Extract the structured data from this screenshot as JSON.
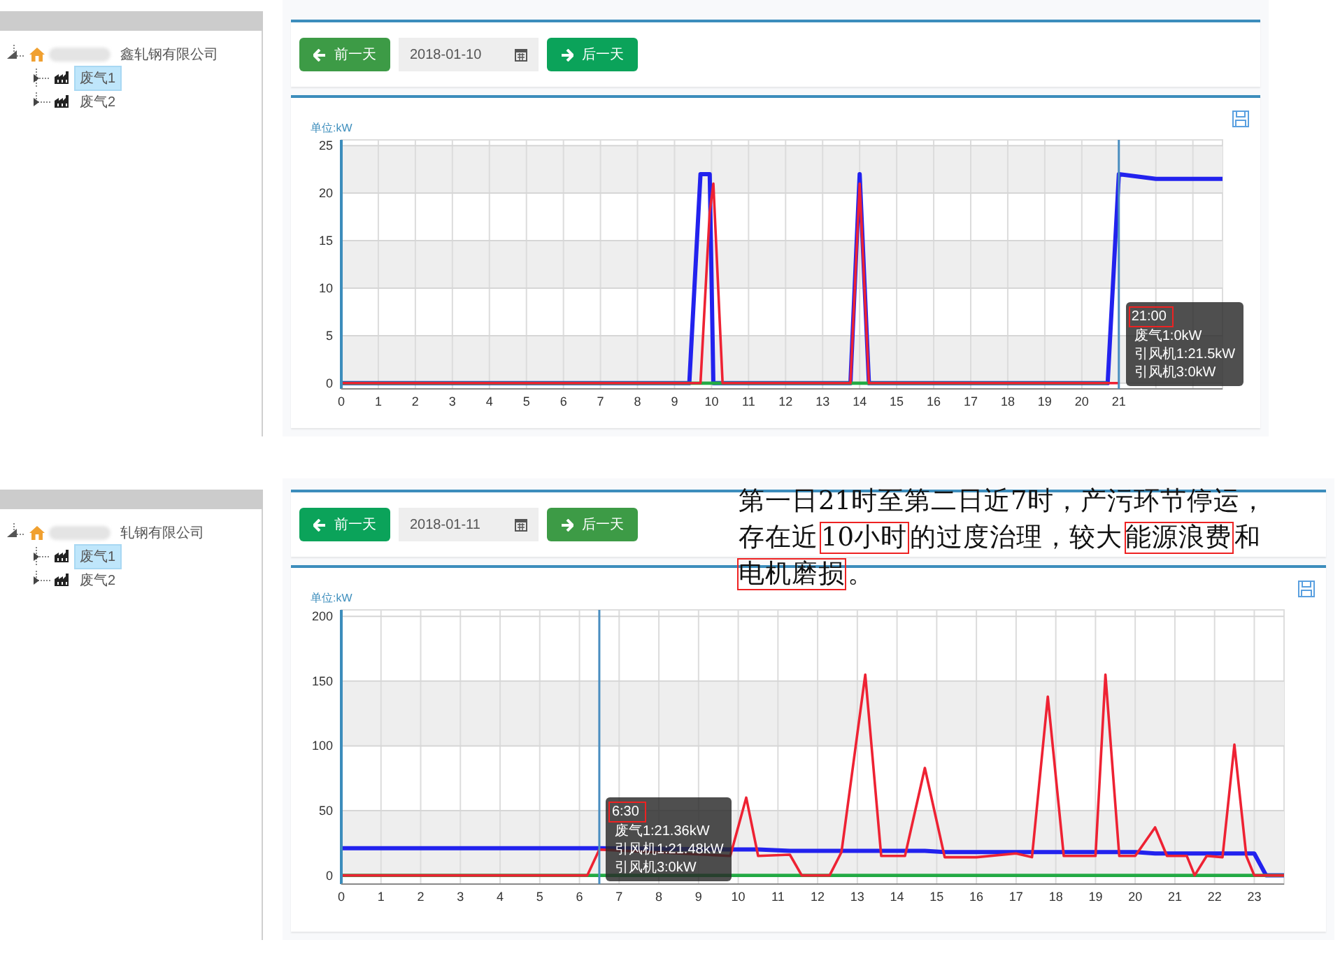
{
  "screens": [
    {
      "sidebar": {
        "tree": [
          {
            "label": "鑫轧钢有限公司",
            "redacted": true,
            "expanded": true,
            "children": [
              {
                "label": "废气1",
                "selected": true
              },
              {
                "label": "废气2",
                "selected": false
              }
            ]
          }
        ]
      },
      "toolbar": {
        "prev_button": {
          "label": "前一天",
          "hovered": true
        },
        "date_field": {
          "value": "2018-01-10"
        },
        "next_button": {
          "label": "后一天",
          "hovered": false
        }
      },
      "chart": {
        "unit_label": "单位:kW",
        "chart_data": {
          "type": "line",
          "x": [
            0,
            9.4,
            9.7,
            9.95,
            10.05,
            10.3,
            13.75,
            14,
            14.25,
            20.7,
            21,
            22,
            23,
            23.8
          ],
          "series": [
            {
              "color": "#2222ee",
              "values": [
                0,
                0,
                22,
                22,
                0,
                0,
                0,
                22,
                0,
                0,
                22,
                21.5,
                21.5,
                21.5
              ]
            },
            {
              "color": "#22aa44",
              "values": [
                0,
                0,
                0,
                0,
                0,
                0,
                0,
                0,
                0,
                0,
                null,
                null,
                null,
                null
              ]
            },
            {
              "color": "#ee2233",
              "values": [
                0,
                0,
                0,
                18,
                21,
                0,
                0,
                21,
                0,
                0,
                0,
                null,
                null,
                null
              ]
            }
          ],
          "xlim": [
            0,
            23.8
          ],
          "ylim": [
            -0.6,
            25.6
          ],
          "xticks": [
            0,
            1,
            2,
            3,
            4,
            5,
            6,
            7,
            8,
            9,
            10,
            11,
            12,
            13,
            14,
            15,
            16,
            17,
            18,
            19,
            20,
            21
          ],
          "yticks": [
            0,
            5,
            10,
            15,
            20,
            25
          ],
          "grid": true,
          "ref_lines": [
            {
              "axis": "x",
              "value": 21
            }
          ]
        },
        "tooltip": {
          "title": "21:00",
          "title_boxed": true,
          "lines": [
            "废气1:0kW",
            "引风机1:21.5kW",
            "引风机3:0kW"
          ]
        }
      }
    },
    {
      "sidebar": {
        "tree": [
          {
            "label": "轧钢有限公司",
            "redacted": true,
            "expanded": true,
            "children": [
              {
                "label": "废气1",
                "selected": true
              },
              {
                "label": "废气2",
                "selected": false
              }
            ]
          }
        ]
      },
      "toolbar": {
        "prev_button": {
          "label": "前一天",
          "hovered": false
        },
        "date_field": {
          "value": "2018-01-11"
        },
        "next_button": {
          "label": "后一天",
          "hovered": true
        }
      },
      "annotation": {
        "lines": [
          [
            {
              "text": "第一日21时至第二日近7时，产污环节停运，",
              "boxed": false
            }
          ],
          [
            {
              "text": "存在近",
              "boxed": false
            },
            {
              "text": "10小时",
              "boxed": true
            },
            {
              "text": "的过度治理，较大",
              "boxed": false
            },
            {
              "text": "能源浪费",
              "boxed": true
            },
            {
              "text": "和",
              "boxed": false
            }
          ],
          [
            {
              "text": "电机磨损",
              "boxed": true
            },
            {
              "text": "。",
              "boxed": false
            }
          ]
        ]
      },
      "chart": {
        "unit_label": "单位:kW",
        "chart_data": {
          "type": "line",
          "x": [
            0,
            6.2,
            6.5,
            9.8,
            10.2,
            10.5,
            11.3,
            11.6,
            12.3,
            12.6,
            13.2,
            13.6,
            14.2,
            14.7,
            15.2,
            16,
            17,
            17.4,
            17.8,
            18.2,
            19,
            19.25,
            19.6,
            20,
            20.5,
            20.8,
            21.3,
            21.5,
            21.8,
            22.2,
            22.5,
            22.8,
            23,
            23.3,
            23.75
          ],
          "series": [
            {
              "color": "#2222ee",
              "values": [
                21,
                21,
                21,
                20,
                20,
                20,
                19,
                19,
                19,
                19,
                19,
                19,
                19,
                19,
                18,
                18,
                18,
                18,
                18,
                18,
                18,
                18,
                18,
                18,
                17,
                17,
                17,
                17,
                17,
                17,
                17,
                17,
                17,
                0,
                0
              ]
            },
            {
              "color": "#22aa44",
              "values": [
                0,
                0,
                0,
                0,
                0,
                0,
                0,
                0,
                0,
                0,
                0,
                0,
                0,
                0,
                0,
                0,
                0,
                0,
                0,
                0,
                0,
                0,
                0,
                0,
                0,
                0,
                0,
                0,
                0,
                0,
                0,
                0,
                0,
                0,
                0
              ]
            },
            {
              "color": "#ee2233",
              "values": [
                0,
                0,
                20,
                15,
                60,
                15,
                16,
                0,
                0,
                18,
                155,
                15,
                15,
                83,
                14,
                14,
                17,
                14,
                138,
                15,
                15,
                155,
                15,
                15,
                37,
                15,
                15,
                0,
                15,
                14,
                101,
                15,
                0,
                0,
                0
              ]
            }
          ],
          "xlim": [
            0,
            23.75
          ],
          "ylim": [
            -6.7,
            205
          ],
          "xticks": [
            0,
            1,
            2,
            3,
            4,
            5,
            6,
            7,
            8,
            9,
            10,
            11,
            12,
            13,
            14,
            15,
            16,
            17,
            18,
            19,
            20,
            21,
            22,
            23
          ],
          "yticks": [
            0,
            50,
            100,
            150,
            200
          ],
          "grid": true,
          "ref_lines": [
            {
              "axis": "x",
              "value": 6.5
            }
          ]
        },
        "tooltip": {
          "title": "6:30",
          "title_boxed": true,
          "lines": [
            "废气1:21.36kW",
            "引风机1:21.48kW",
            "引风机3:0kW"
          ]
        }
      }
    }
  ]
}
